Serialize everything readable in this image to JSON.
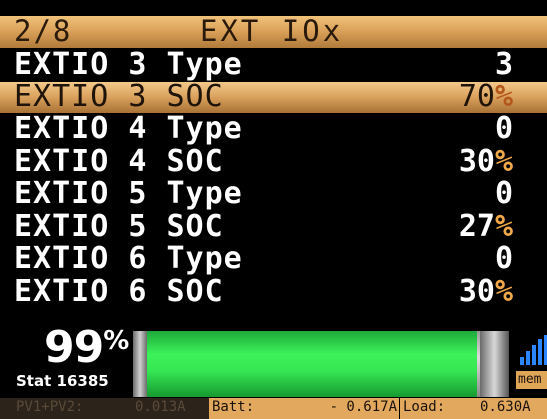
{
  "header": {
    "page": "2/8",
    "title": "EXT IOx"
  },
  "rows": [
    {
      "label": "EXTIO 3 Type",
      "value": "3",
      "unit": ""
    },
    {
      "label": "EXTIO 3 SOC",
      "value": "70",
      "unit": "%"
    },
    {
      "label": "EXTIO 4 Type",
      "value": "0",
      "unit": ""
    },
    {
      "label": "EXTIO 4 SOC",
      "value": "30",
      "unit": "%"
    },
    {
      "label": "EXTIO 5 Type",
      "value": "0",
      "unit": ""
    },
    {
      "label": "EXTIO 5 SOC",
      "value": "27",
      "unit": "%"
    },
    {
      "label": "EXTIO 6 Type",
      "value": "0",
      "unit": ""
    },
    {
      "label": "EXTIO 6 SOC",
      "value": "30",
      "unit": "%"
    }
  ],
  "selected_row": "EXTIO 3 SOC",
  "status": {
    "battery_percent": "99",
    "percent_symbol": "%",
    "battery_level": 0.99,
    "stat_label": "Stat",
    "stat_value": "16385",
    "signal_icon": "signal-bars-icon",
    "mem_label": "mem"
  },
  "footer": {
    "pv_label": "PV1+PV2:",
    "pv_value": "0.013A",
    "batt_label": "Batt:",
    "batt_value": "- 0.617A",
    "load_label": "Load:",
    "load_value": "0.630A"
  },
  "colors": {
    "highlight": "#dba25a",
    "percent_accent": "#f0a948",
    "bar_green": "#3cf25a",
    "signal_blue": "#2b86ff"
  }
}
